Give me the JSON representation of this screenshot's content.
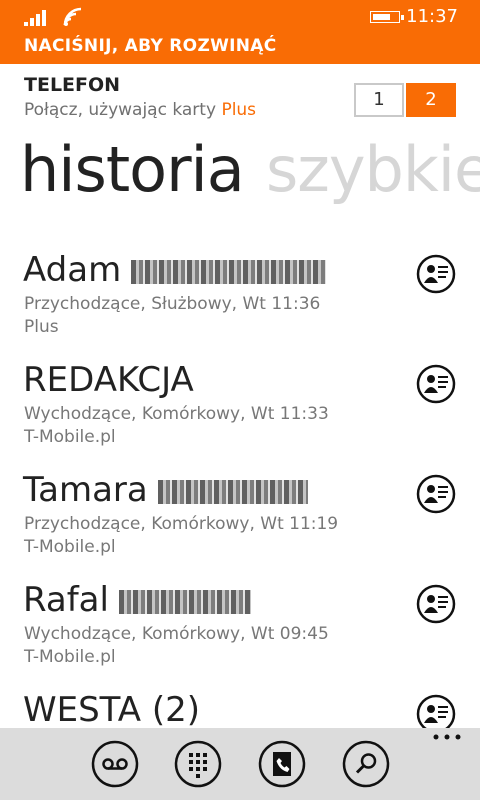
{
  "status_bar": {
    "time": "11:37",
    "battery_level": 0.75,
    "signal_bars": 4
  },
  "banner": {
    "text": "NACIŚNIJ, ABY ROZWINĄĆ"
  },
  "header": {
    "app_title": "TELEFON",
    "subtitle_prefix": "Połącz, używając karty ",
    "subtitle_sim": "Plus",
    "sim_options": [
      "1",
      "2"
    ],
    "selected_sim": "2"
  },
  "pivot": {
    "active": "historia",
    "next": "szybkie"
  },
  "calls": [
    {
      "name": "Adam",
      "detail": "Przychodzące, Służbowy, Wt 11:36",
      "network": "Plus"
    },
    {
      "name": "REDAKCJA",
      "detail": "Wychodzące, Komórkowy, Wt 11:33",
      "network": "T-Mobile.pl"
    },
    {
      "name": "Tamara",
      "detail": "Przychodzące, Komórkowy, Wt 11:19",
      "network": "T-Mobile.pl"
    },
    {
      "name": "Rafal",
      "detail": "Wychodzące, Komórkowy, Wt 09:45",
      "network": "T-Mobile.pl"
    },
    {
      "name": "WESTA (2)",
      "detail": "",
      "network": ""
    }
  ],
  "app_bar": {
    "buttons": [
      "voicemail-icon",
      "keypad-icon",
      "people-icon",
      "search-icon"
    ],
    "more": "more-options-icon"
  },
  "colors": {
    "accent": "#f96c05",
    "app_bar": "#dcdcdc",
    "secondary_text": "#777777"
  }
}
